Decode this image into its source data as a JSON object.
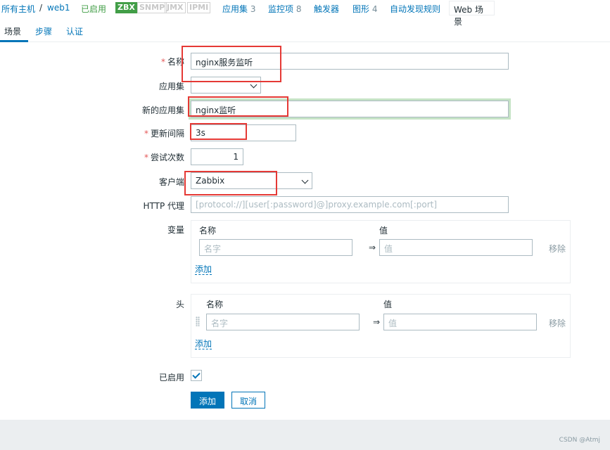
{
  "nav": {
    "all_hosts": "所有主机",
    "slash": "/",
    "host": "web1",
    "status": "已启用",
    "zbx": "ZBX",
    "snmp": "SNMP",
    "jmx": "JMX",
    "ipmi": "IPMI",
    "applications": "应用集",
    "applications_count": "3",
    "items": "监控项",
    "items_count": "8",
    "triggers": "触发器",
    "graphs": "图形",
    "graphs_count": "4",
    "discovery": "自动发现规则",
    "web": "Web 场景"
  },
  "tabs": [
    "场景",
    "步骤",
    "认证"
  ],
  "form": {
    "name_label": "名称",
    "name_value": "nginx服务监听",
    "app_label": "应用集",
    "new_app_label": "新的应用集",
    "new_app_value": "nginx监听",
    "interval_label": "更新间隔",
    "interval_value": "3s",
    "attempts_label": "尝试次数",
    "attempts_value": "1",
    "agent_label": "客户端",
    "agent_value": "Zabbix",
    "proxy_label": "HTTP 代理",
    "proxy_placeholder": "[protocol://][user[:password]@]proxy.example.com[:port]",
    "variables_label": "变量",
    "headers_label": "头",
    "col_name": "名称",
    "col_value": "值",
    "name_placeholder": "名字",
    "value_placeholder": "值",
    "arrow": "⇒",
    "remove": "移除",
    "add": "添加",
    "enabled_label": "已启用",
    "enabled": true
  },
  "buttons": {
    "add": "添加",
    "cancel": "取消"
  },
  "watermark": "CSDN @Atmj",
  "colors": {
    "accent": "#0275b8",
    "enabled": "#429e47",
    "highlight": "#e53935"
  }
}
